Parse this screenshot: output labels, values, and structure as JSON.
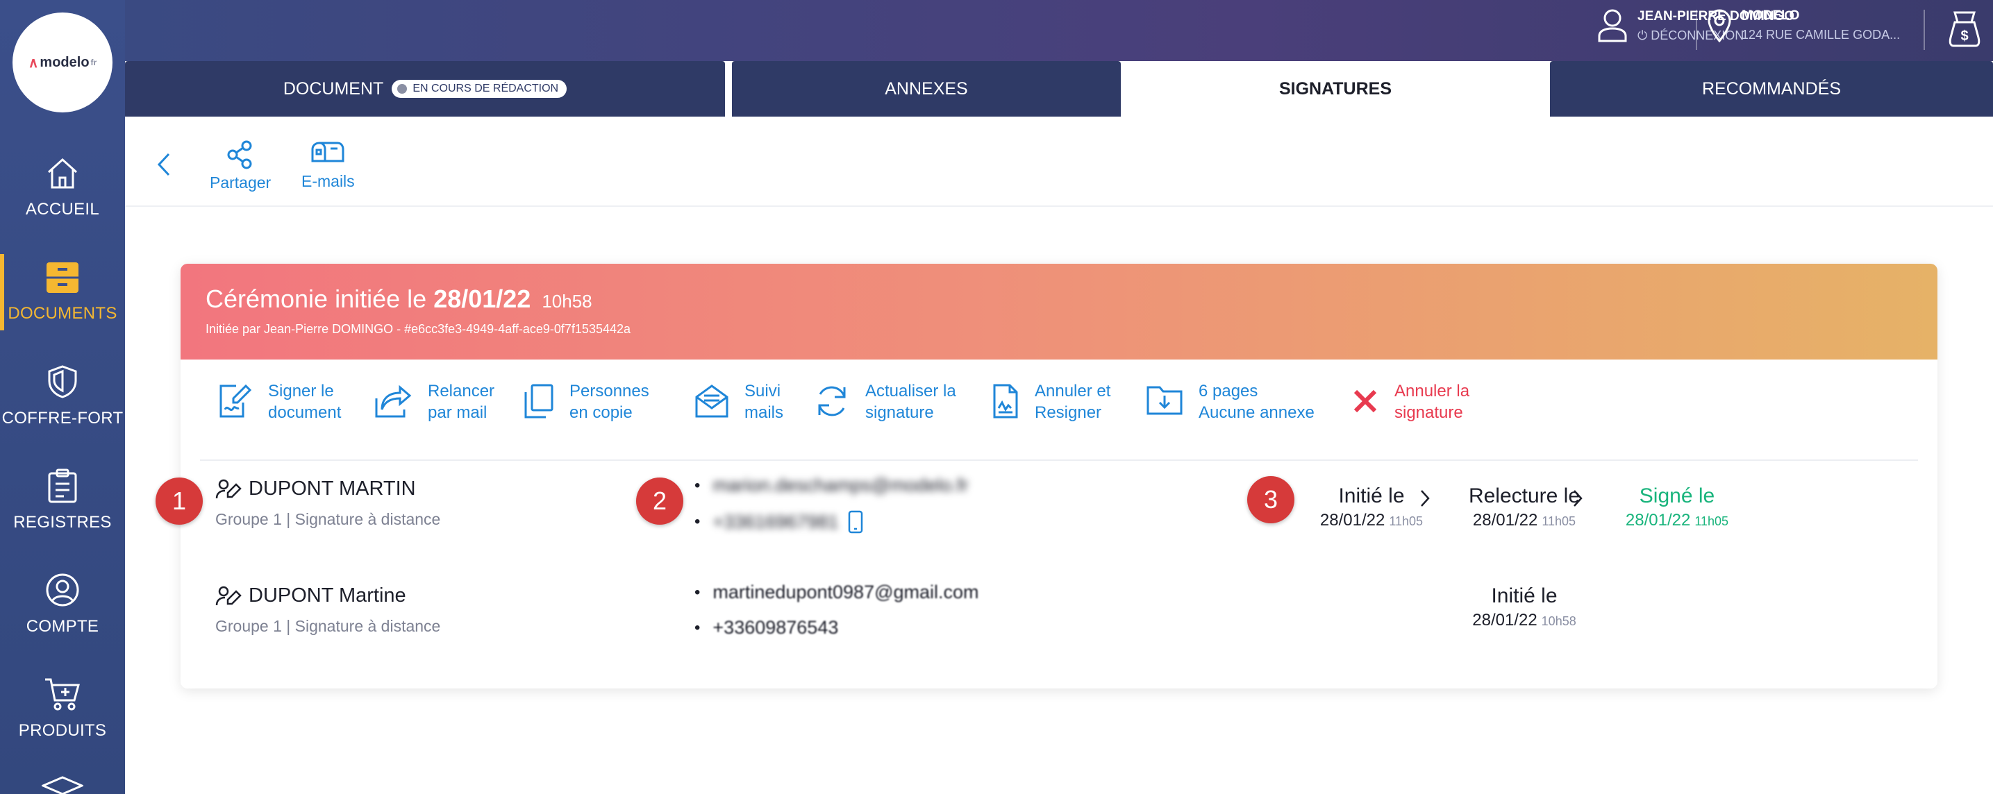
{
  "brand": {
    "logo_text": "modelo",
    "logo_suffix": "fr"
  },
  "sidebar": {
    "items": [
      {
        "label": "ACCUEIL",
        "icon": "home-icon"
      },
      {
        "label": "DOCUMENTS",
        "icon": "drawer-icon"
      },
      {
        "label": "COFFRE-FORT",
        "icon": "shield-icon"
      },
      {
        "label": "REGISTRES",
        "icon": "clipboard-icon"
      },
      {
        "label": "COMPTE",
        "icon": "user-circle-icon"
      },
      {
        "label": "PRODUITS",
        "icon": "cart-icon"
      }
    ],
    "active": "DOCUMENTS"
  },
  "header": {
    "user_name": "JEAN-PIERRE DOMINGO",
    "logout": "DÉCONNEXION",
    "office_name": "MODELO",
    "office_address": "124 RUE CAMILLE GODA..."
  },
  "tabs": [
    {
      "label": "DOCUMENT",
      "badge": "EN COURS DE RÉDACTION"
    },
    {
      "label": "ANNEXES"
    },
    {
      "label": "SIGNATURES"
    },
    {
      "label": "RECOMMANDÉS"
    }
  ],
  "active_tab": "SIGNATURES",
  "toolbar": {
    "share": "Partager",
    "emails": "E-mails"
  },
  "ceremony": {
    "title_prefix": "Cérémonie initiée le",
    "date": "28/01/22",
    "time": "10h58",
    "subtitle": "Initiée par Jean-Pierre DOMINGO - #e6cc3fe3-4949-4aff-ace9-0f7f1535442a"
  },
  "actions": [
    {
      "l1": "Signer le",
      "l2": "document",
      "icon": "sign-document-icon"
    },
    {
      "l1": "Relancer",
      "l2": "par mail",
      "icon": "forward-icon"
    },
    {
      "l1": "Personnes",
      "l2": "en copie",
      "icon": "copy-icon"
    },
    {
      "l1": "Suivi",
      "l2": "mails",
      "icon": "mail-open-icon"
    },
    {
      "l1": "Actualiser la",
      "l2": "signature",
      "icon": "refresh-icon"
    },
    {
      "l1": "Annuler et",
      "l2": "Resigner",
      "icon": "document-sign-icon"
    },
    {
      "l1": "6 pages",
      "l2": "Aucune annexe",
      "icon": "folder-download-icon"
    },
    {
      "l1": "Annuler la",
      "l2": "signature",
      "icon": "cross-icon"
    }
  ],
  "signers": [
    {
      "name": "DUPONT MARTIN",
      "group": "Groupe 1 | Signature à distance",
      "email": "marion.deschamps@modelo.fr",
      "phone": "+33616967981",
      "steps": [
        {
          "label": "Initié le",
          "date": "28/01/22",
          "time": "11h05"
        },
        {
          "label": "Relecture le",
          "date": "28/01/22",
          "time": "11h05"
        },
        {
          "label": "Signé le",
          "date": "28/01/22",
          "time": "11h05"
        }
      ]
    },
    {
      "name": "DUPONT Martine",
      "group": "Groupe 1 | Signature à distance",
      "email": "martinedupont0987@gmail.com",
      "phone": "+33609876543",
      "steps": [
        {
          "label": "Initié le",
          "date": "28/01/22",
          "time": "10h58"
        }
      ]
    }
  ],
  "markers": [
    "1",
    "2",
    "3"
  ],
  "colors": {
    "accent": "#1f86d8",
    "danger": "#e83a4f",
    "success": "#19b47c",
    "sidebar": "#3b4f8a",
    "active_nav": "#f5b731"
  }
}
